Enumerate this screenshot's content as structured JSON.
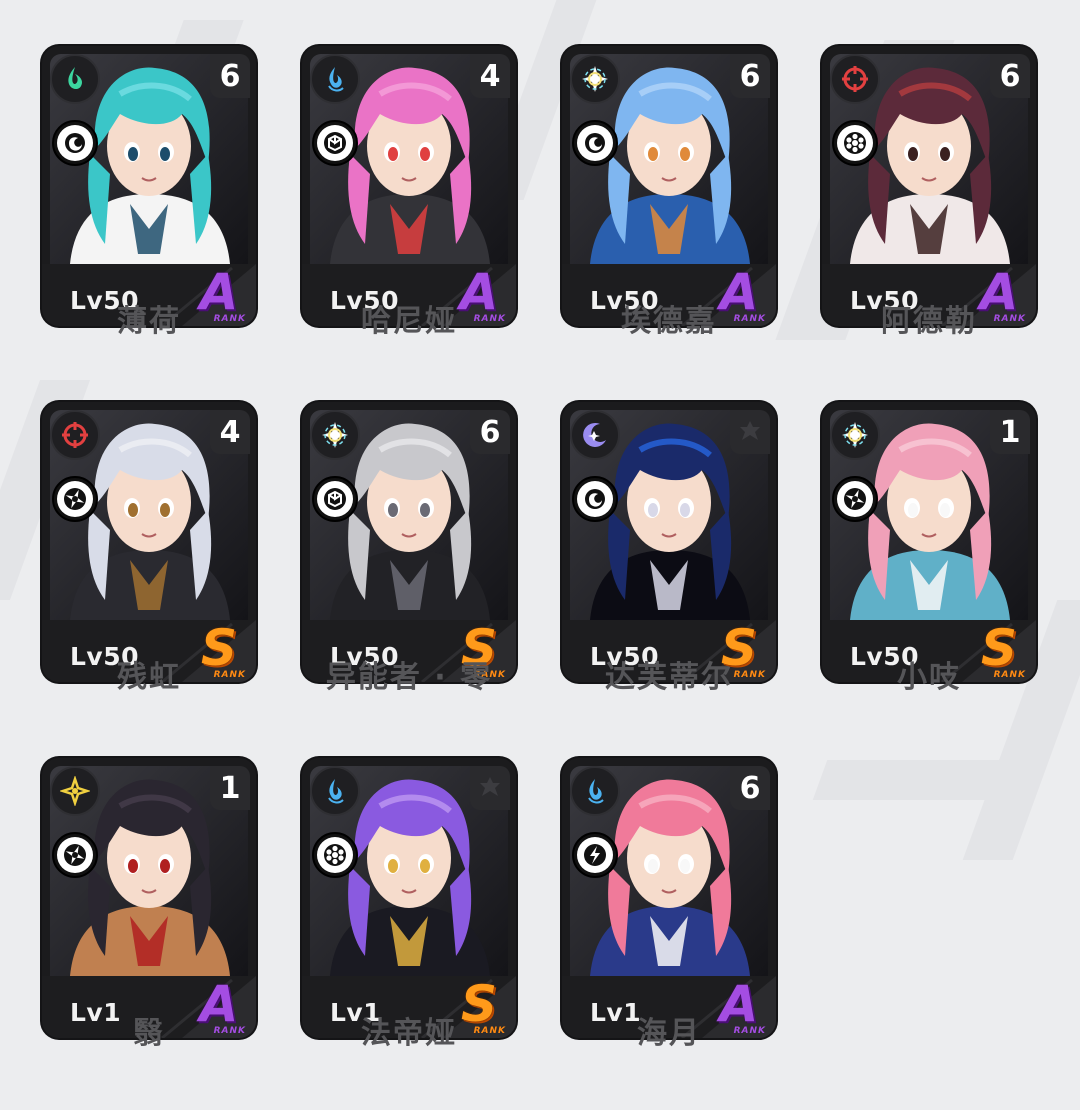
{
  "agents": [
    {
      "name": "薄荷",
      "level": "Lv50",
      "rank": "A",
      "rank_sub": "RANK",
      "mindscape": "6",
      "element": "ether-icon",
      "element_color": "#3cd6a0",
      "specialty": "anomaly-icon",
      "palette": [
        "#3bc6c8",
        "#7fe3e8",
        "#f4f4f4",
        "#1d4d6b"
      ]
    },
    {
      "name": "哈尼娅",
      "level": "Lv50",
      "rank": "A",
      "rank_sub": "RANK",
      "mindscape": "4",
      "element": "ice-icon",
      "element_color": "#4bb2f0",
      "specialty": "defense-icon",
      "palette": [
        "#ea73c6",
        "#f7a8dd",
        "#333338",
        "#e04040"
      ]
    },
    {
      "name": "埃德嘉",
      "level": "Lv50",
      "rank": "A",
      "rank_sub": "RANK",
      "mindscape": "6",
      "element": "ether-star-icon",
      "element_color": "#f2e07a",
      "specialty": "anomaly-icon",
      "palette": [
        "#7fb6f0",
        "#b8d8fa",
        "#2a5fae",
        "#e08a3a"
      ]
    },
    {
      "name": "阿德勒",
      "level": "Lv50",
      "rank": "A",
      "rank_sub": "RANK",
      "mindscape": "6",
      "element": "fire-icon",
      "element_color": "#e34040",
      "specialty": "support-icon",
      "palette": [
        "#5c2a3a",
        "#c24040",
        "#f0e8e8",
        "#3a2020"
      ]
    },
    {
      "name": "残虹",
      "level": "Lv50",
      "rank": "S",
      "rank_sub": "RANK",
      "mindscape": "4",
      "element": "fire-icon",
      "element_color": "#e34040",
      "specialty": "attack-icon",
      "palette": [
        "#d8dce8",
        "#f2f2f6",
        "#2a2a30",
        "#a07030"
      ]
    },
    {
      "name": "异能者 · 零",
      "level": "Lv50",
      "rank": "S",
      "rank_sub": "RANK",
      "mindscape": "6",
      "element": "ether-star-icon",
      "element_color": "#f2e07a",
      "specialty": "defense-icon",
      "palette": [
        "#c8c8cc",
        "#ececf0",
        "#222226",
        "#6a6a74"
      ]
    },
    {
      "name": "达芙蒂尔",
      "level": "Lv50",
      "rank": "S",
      "rank_sub": "RANK",
      "mindscape": "",
      "element": "moon-icon",
      "element_color": "#9a8cf0",
      "specialty": "anomaly-icon",
      "palette": [
        "#1a2a6a",
        "#2a6ef0",
        "#0c0c14",
        "#d8d8e8"
      ]
    },
    {
      "name": "小吱",
      "level": "Lv50",
      "rank": "S",
      "rank_sub": "RANK",
      "mindscape": "1",
      "element": "ether-star-icon",
      "element_color": "#f2e07a",
      "specialty": "attack-icon",
      "palette": [
        "#f0a0b8",
        "#fad0dc",
        "#60b0c8",
        "#f8f8f8"
      ]
    },
    {
      "name": "翳",
      "level": "Lv1",
      "rank": "A",
      "rank_sub": "RANK",
      "mindscape": "1",
      "element": "electric-icon",
      "element_color": "#f0d040",
      "specialty": "attack-icon",
      "palette": [
        "#2a2630",
        "#4a4050",
        "#c08050",
        "#b02020"
      ]
    },
    {
      "name": "法帝娅",
      "level": "Lv1",
      "rank": "S",
      "rank_sub": "RANK",
      "mindscape": "",
      "element": "ice-icon",
      "element_color": "#4bb2f0",
      "specialty": "support-icon",
      "palette": [
        "#8a5ae0",
        "#c4a0f4",
        "#1a1a22",
        "#e0b040"
      ]
    },
    {
      "name": "海月",
      "level": "Lv1",
      "rank": "A",
      "rank_sub": "RANK",
      "mindscape": "6",
      "element": "ice-icon",
      "element_color": "#4bb2f0",
      "specialty": "rupture-icon",
      "palette": [
        "#f07a9a",
        "#f8b8c8",
        "#2a3a8a",
        "#f8f8f8"
      ]
    }
  ]
}
